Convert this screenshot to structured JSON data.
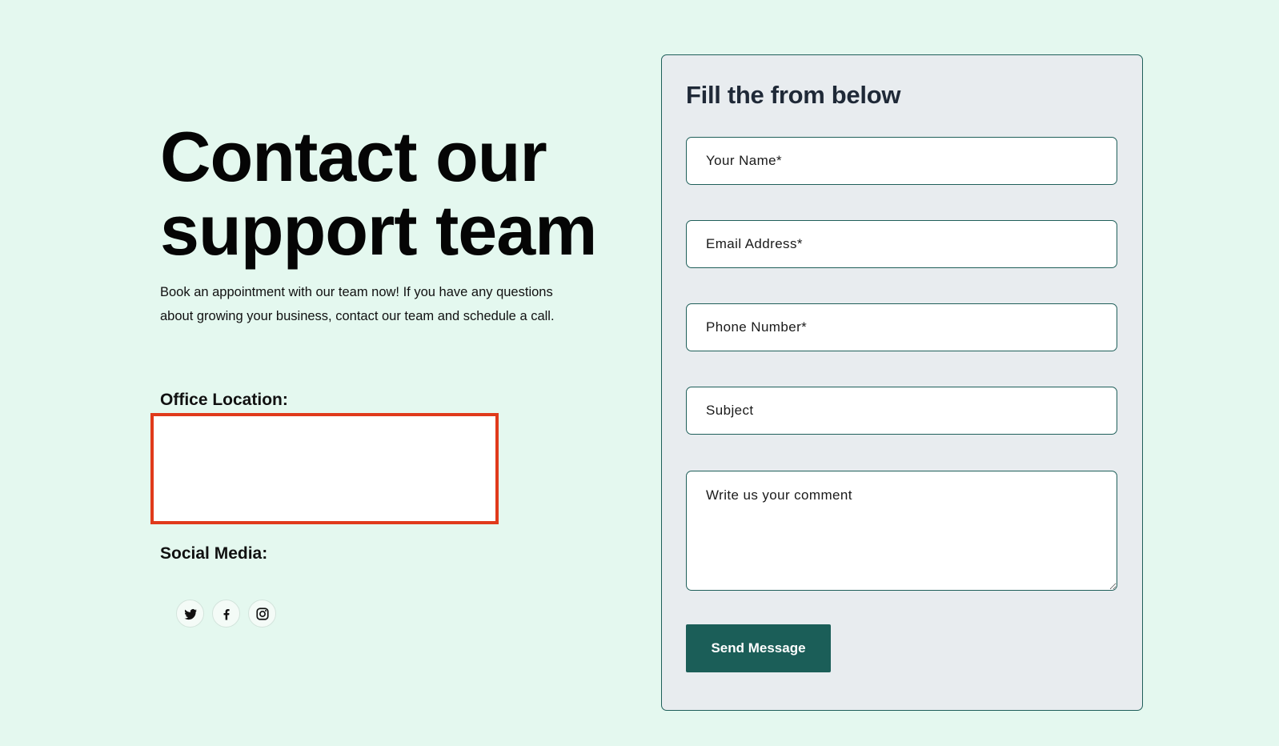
{
  "hero": {
    "title_line1": "Contact our",
    "title_line2": "support team",
    "description": "Book an appointment with our team now! If you have any questions about growing your business, contact our team and schedule a call."
  },
  "office": {
    "label": "Office Location:"
  },
  "social": {
    "label": "Social Media:",
    "icons": [
      "twitter-icon",
      "facebook-icon",
      "instagram-icon"
    ]
  },
  "form": {
    "title": "Fill the from below",
    "name_placeholder": "Your Name*",
    "email_placeholder": "Email Address*",
    "phone_placeholder": "Phone Number*",
    "subject_placeholder": "Subject",
    "comment_placeholder": "Write us your comment",
    "submit_label": "Send Message"
  },
  "colors": {
    "page_background": "#e4f8ef",
    "card_background": "#e8ecef",
    "accent": "#1b5e58",
    "highlight_border": "#e03a1b"
  }
}
